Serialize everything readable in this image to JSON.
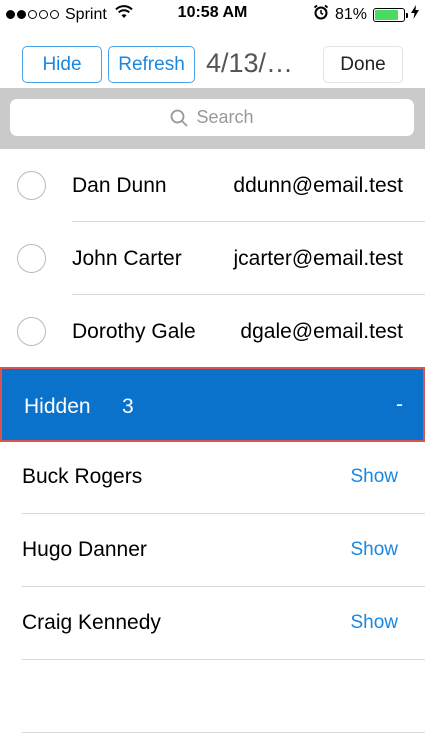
{
  "status_bar": {
    "carrier": "Sprint",
    "time": "10:58 AM",
    "battery_percent": "81%",
    "battery_level": 0.81,
    "signal_filled": 2,
    "signal_total": 5
  },
  "toolbar": {
    "hide_label": "Hide",
    "refresh_label": "Refresh",
    "title": "4/13/…",
    "done_label": "Done"
  },
  "search": {
    "placeholder": "Search"
  },
  "contacts": [
    {
      "name": "Dan Dunn",
      "email": "ddunn@email.test"
    },
    {
      "name": "John Carter",
      "email": "jcarter@email.test"
    },
    {
      "name": "Dorothy Gale",
      "email": "dgale@email.test"
    }
  ],
  "hidden_section": {
    "label": "Hidden",
    "count": "3",
    "toggle": "-",
    "accent_color": "#0b72cc"
  },
  "hidden_contacts": [
    {
      "name": "Buck Rogers",
      "action": "Show"
    },
    {
      "name": "Hugo Danner",
      "action": "Show"
    },
    {
      "name": "Craig Kennedy",
      "action": "Show"
    }
  ]
}
